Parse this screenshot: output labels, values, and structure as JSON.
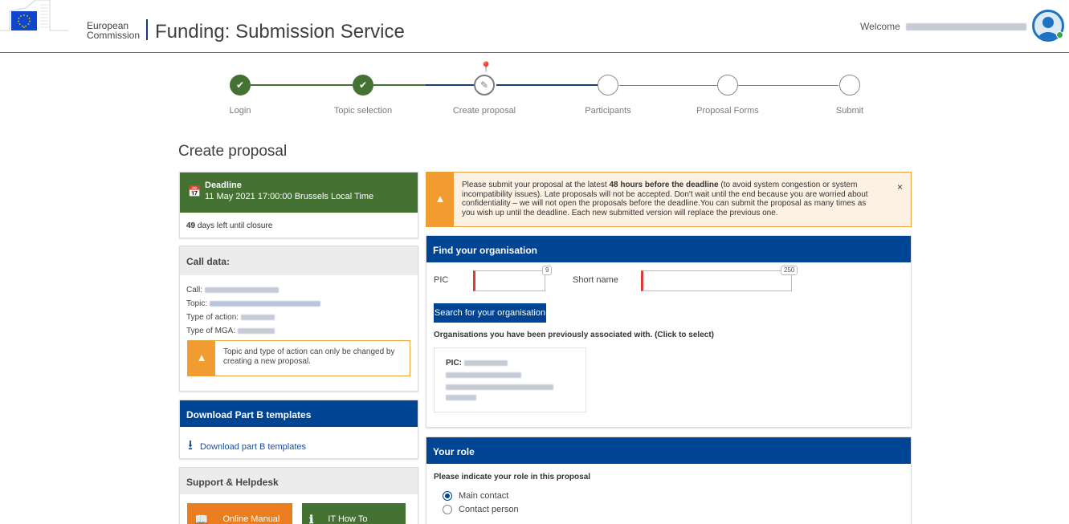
{
  "header": {
    "org_line1": "European",
    "org_line2": "Commission",
    "app_title": "Funding: Submission Service",
    "welcome_label": "Welcome"
  },
  "stepper": {
    "steps": [
      {
        "label": "Login",
        "state": "done"
      },
      {
        "label": "Topic selection",
        "state": "done"
      },
      {
        "label": "Create proposal",
        "state": "current"
      },
      {
        "label": "Participants",
        "state": "todo"
      },
      {
        "label": "Proposal Forms",
        "state": "todo"
      },
      {
        "label": "Submit",
        "state": "todo"
      }
    ]
  },
  "page_title": "Create proposal",
  "deadline": {
    "heading": "Deadline",
    "date": "11 May 2021 17:00:00 Brussels Local Time",
    "days_left": "49",
    "days_left_suffix": " days left until closure"
  },
  "call_data": {
    "heading": "Call data:",
    "call_label": "Call:",
    "topic_label": "Topic:",
    "action_label": "Type of action:",
    "mga_label": "Type of MGA:",
    "warning": "Topic and type of action can only be changed by creating a new proposal."
  },
  "download": {
    "heading": "Download Part B templates",
    "link": "Download part B templates"
  },
  "support": {
    "heading": "Support & Helpdesk",
    "online_manual": "Online Manual",
    "it_howto": "IT How To"
  },
  "alert": {
    "text_before": "Please submit your proposal at the latest ",
    "text_bold": "48 hours before the deadline",
    "text_after": " (to avoid system congestion or system incompatibility issues). Late proposals will not be accepted. Don't wait until the end because you are worried about confidentiality – we will not open the proposals before the deadline.You can submit the proposal as many times as you wish up until the deadline. Each new submitted version will replace the previous one.",
    "close": "×"
  },
  "find_org": {
    "heading": "Find your organisation",
    "pic_label": "PIC",
    "pic_counter": "9",
    "short_name_label": "Short name",
    "short_name_counter": "250",
    "pic_value": "",
    "short_name_value": "",
    "search_button": "Search for your organisation",
    "previous_label": "Organisations you have been previously associated with. (Click to select)",
    "org_pic_label": "PIC:"
  },
  "your_role": {
    "heading": "Your role",
    "question": "Please indicate your role in this proposal",
    "options": [
      {
        "label": "Main contact",
        "selected": true
      },
      {
        "label": "Contact person",
        "selected": false
      }
    ]
  },
  "colors": {
    "green": "#447232",
    "blue": "#004494",
    "orange": "#ea7d1d",
    "warning": "#f29b31"
  },
  "icons": [
    "check-icon",
    "pencil-icon",
    "location-pin-icon",
    "calendar-icon",
    "warning-icon",
    "download-icon",
    "book-icon",
    "info-icon",
    "close-icon"
  ]
}
